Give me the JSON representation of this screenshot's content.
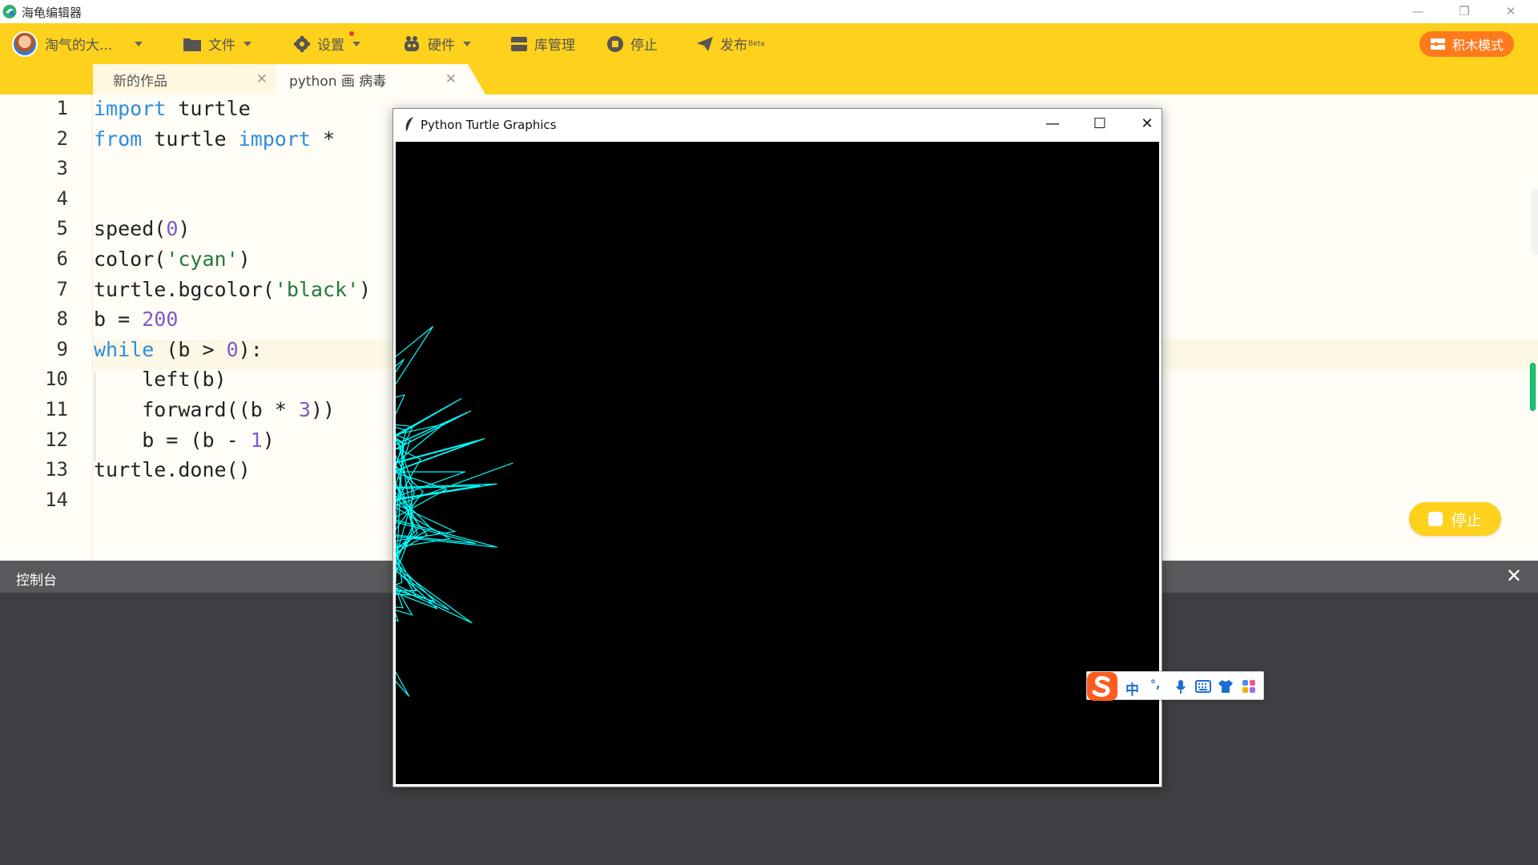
{
  "app": {
    "title": "海龟编辑器",
    "controls": {
      "minimize": "—",
      "restore": "❐",
      "close": "✕"
    }
  },
  "toolbar": {
    "user_name": "淘气的大...",
    "file_label": "文件",
    "settings_label": "设置",
    "hardware_label": "硬件",
    "library_label": "库管理",
    "stop_label": "停止",
    "publish_label": "发布",
    "publish_badge": "Beta",
    "block_mode_label": "积木模式",
    "accent_color": "#fed11c",
    "block_mode_color": "#ff7a1c"
  },
  "tabs": [
    {
      "label": "新的作品",
      "active": false
    },
    {
      "label": "python 画 病毒",
      "active": true
    }
  ],
  "tab_close_glyph": "✕",
  "editor": {
    "line_numbers": [
      "1",
      "2",
      "3",
      "4",
      "5",
      "6",
      "7",
      "8",
      "9",
      "10",
      "11",
      "12",
      "13",
      "14"
    ],
    "highlighted_line": 9,
    "lines": [
      [
        {
          "t": "import",
          "c": "kw"
        },
        {
          "t": " turtle",
          "c": ""
        }
      ],
      [
        {
          "t": "from",
          "c": "kw"
        },
        {
          "t": " turtle ",
          "c": ""
        },
        {
          "t": "import",
          "c": "kw"
        },
        {
          "t": " *",
          "c": ""
        }
      ],
      [],
      [],
      [
        {
          "t": "speed(",
          "c": ""
        },
        {
          "t": "0",
          "c": "num"
        },
        {
          "t": ")",
          "c": ""
        }
      ],
      [
        {
          "t": "color(",
          "c": ""
        },
        {
          "t": "'cyan'",
          "c": "str"
        },
        {
          "t": ")",
          "c": ""
        }
      ],
      [
        {
          "t": "turtle.bgcolor(",
          "c": ""
        },
        {
          "t": "'black'",
          "c": "str"
        },
        {
          "t": ")",
          "c": ""
        }
      ],
      [
        {
          "t": "b = ",
          "c": ""
        },
        {
          "t": "200",
          "c": "num"
        }
      ],
      [
        {
          "t": "while",
          "c": "kw"
        },
        {
          "t": " (b > ",
          "c": ""
        },
        {
          "t": "0",
          "c": "num"
        },
        {
          "t": "):",
          "c": ""
        }
      ],
      [
        {
          "t": "    left(b)",
          "c": ""
        }
      ],
      [
        {
          "t": "    forward((b * ",
          "c": ""
        },
        {
          "t": "3",
          "c": "num"
        },
        {
          "t": "))",
          "c": ""
        }
      ],
      [
        {
          "t": "    b = (b - ",
          "c": ""
        },
        {
          "t": "1",
          "c": "num"
        },
        {
          "t": ")",
          "c": ""
        }
      ],
      [
        {
          "t": "turtle.done()",
          "c": ""
        }
      ],
      []
    ]
  },
  "run_stop_button": {
    "label": "停止"
  },
  "console": {
    "title": "控制台",
    "close_glyph": "✕"
  },
  "turtle_window": {
    "title": "Python Turtle Graphics",
    "controls": {
      "minimize": "—",
      "maximize": "☐",
      "close": "✕"
    },
    "background": "#000000",
    "pen_color": "cyan"
  },
  "ime": {
    "mode_label": "中",
    "punct_label": "°,",
    "icons": [
      "sogou-logo-icon",
      "microphone-icon",
      "keyboard-icon",
      "skin-shirt-icon",
      "toolbox-icon"
    ]
  }
}
